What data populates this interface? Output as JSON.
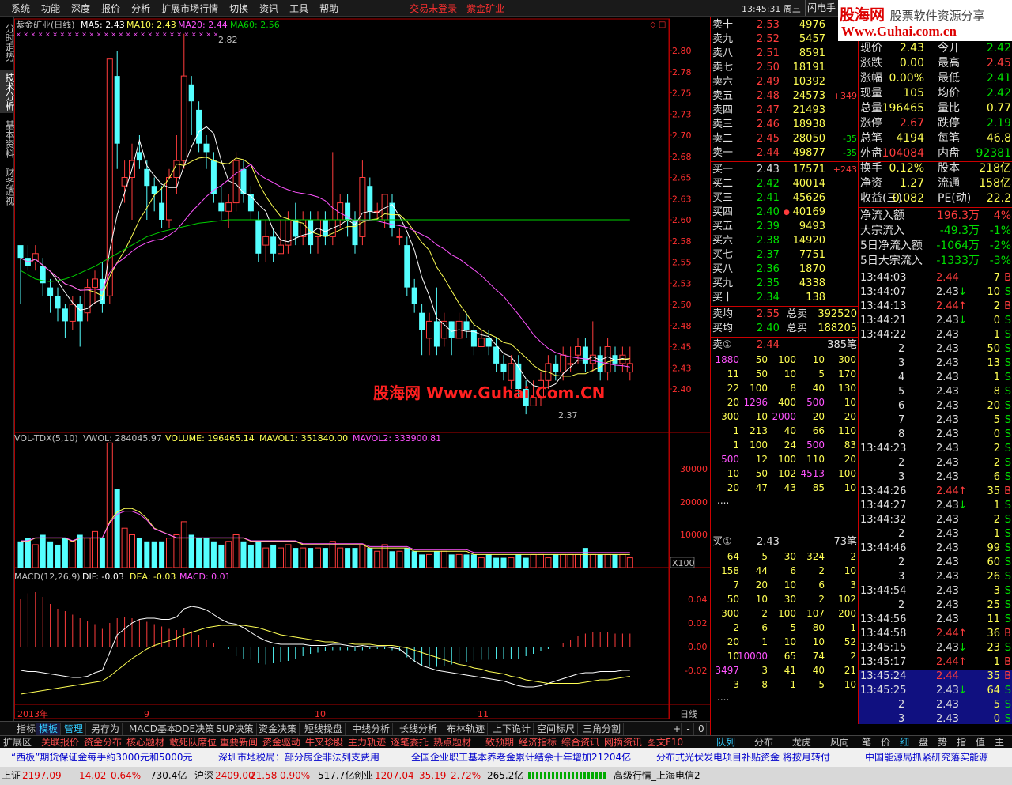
{
  "menu": {
    "items": [
      "系统",
      "功能",
      "深度",
      "报价",
      "分析",
      "扩展市场行情",
      "切换",
      "资讯",
      "工具",
      "帮助"
    ],
    "trade_status": "交易未登录",
    "stock_name": "紫金矿业",
    "clock": "13:45:31 周三",
    "flash": "闪电手"
  },
  "logo": {
    "line1a": "股海网",
    "line1b": "股票软件资源分享",
    "line2": "Www.Guhai.com.cn"
  },
  "side_tabs": [
    "分时走势",
    "技术分析",
    "基本资料",
    "财务透视"
  ],
  "chart": {
    "title": "紫金矿业(日线)",
    "ma5": "MA5: 2.43",
    "ma10": "MA10: 2.43",
    "ma20": "MA20: 2.44",
    "ma60": "MA60: 2.56",
    "high_mark": "2.82",
    "low_mark": "2.37",
    "price_ticks": [
      "2.80",
      "2.78",
      "2.75",
      "2.73",
      "2.70",
      "2.68",
      "2.65",
      "2.63",
      "2.60",
      "2.58",
      "2.55",
      "2.53",
      "2.50",
      "2.48",
      "2.45",
      "2.43",
      "2.40"
    ],
    "watermark": "股海网 Www.Guhai.Com.CN",
    "vol_title": "VOL-TDX(5,10)",
    "vwol": "VWOL: 284045.97",
    "volume": "VOLUME: 196465.14",
    "mavol1": "MAVOL1: 351840.00",
    "mavol2": "MAVOL2: 333900.81",
    "vol_ticks": [
      "30000",
      "20000",
      "10000"
    ],
    "vol_unit": "X100",
    "macd_title": "MACD(12,26,9)",
    "dif": "DIF: -0.03",
    "dea": "DEA: -0.03",
    "macd": "MACD: 0.01",
    "macd_ticks": [
      "0.04",
      "0.02",
      "0.00",
      "-0.02"
    ],
    "x_labels": [
      "2013年",
      "9",
      "10",
      "11"
    ],
    "period": "日线"
  },
  "bottom_tabs": [
    "指标",
    "模板",
    "管理",
    "另存为",
    "MACD基本",
    "DDE决策",
    "SUP决策",
    "资金决策",
    "短线操盘",
    "中线分析",
    "长线分析",
    "布林轨迹",
    "上下诡计",
    "空间标尺",
    "三角分割"
  ],
  "bottom_tab_ctrl": [
    "+",
    "-",
    "0"
  ],
  "tabbar2": [
    "扩展区",
    "关联报价",
    "资金分布",
    "核心题材",
    "敢死队席位",
    "重要新闻",
    "资金驱动",
    "牛叉珍股",
    "主力轨迹",
    "逐笔委托",
    "热点题材",
    "一致预期",
    "经济指标",
    "综合资讯",
    "网摘资讯",
    "图文F10"
  ],
  "tabbar2_right": [
    "队列",
    "分布",
    "龙虎",
    "风向"
  ],
  "tabbar3": [
    "笔",
    "价",
    "细",
    "盘",
    "势",
    "指",
    "值",
    "主"
  ],
  "sells": [
    [
      "卖十",
      "2.53",
      "4976",
      ""
    ],
    [
      "卖九",
      "2.52",
      "5457",
      ""
    ],
    [
      "卖八",
      "2.51",
      "8591",
      ""
    ],
    [
      "卖七",
      "2.50",
      "18191",
      ""
    ],
    [
      "卖六",
      "2.49",
      "10392",
      ""
    ],
    [
      "卖五",
      "2.48",
      "24573",
      "+349"
    ],
    [
      "卖四",
      "2.47",
      "21493",
      ""
    ],
    [
      "卖三",
      "2.46",
      "18938",
      ""
    ],
    [
      "卖二",
      "2.45",
      "28050",
      "-35"
    ],
    [
      "卖一",
      "2.44",
      "49877",
      "-35"
    ]
  ],
  "buys": [
    [
      "买一",
      "2.43",
      "17571",
      "+243"
    ],
    [
      "买二",
      "2.42",
      "40014",
      ""
    ],
    [
      "买三",
      "2.41",
      "45626",
      ""
    ],
    [
      "买四",
      "2.40",
      "40169",
      ""
    ],
    [
      "买五",
      "2.39",
      "9493",
      ""
    ],
    [
      "买六",
      "2.38",
      "14920",
      ""
    ],
    [
      "买七",
      "2.37",
      "7751",
      ""
    ],
    [
      "买八",
      "2.36",
      "1870",
      ""
    ],
    [
      "买九",
      "2.35",
      "4338",
      ""
    ],
    [
      "买十",
      "2.34",
      "138",
      ""
    ]
  ],
  "avg": {
    "sell_avg_label": "卖均",
    "sell_avg": "2.55",
    "sell_total_label": "总卖",
    "sell_total": "392520",
    "buy_avg_label": "买均",
    "buy_avg": "2.40",
    "buy_total_label": "总买",
    "buy_total": "188205"
  },
  "sell_queue": {
    "label": "卖①",
    "price": "2.44",
    "count": "385笔",
    "rows": [
      [
        "1880",
        "50",
        "100",
        "10",
        "300"
      ],
      [
        "11",
        "50",
        "10",
        "5",
        "170"
      ],
      [
        "22",
        "100",
        "8",
        "40",
        "130"
      ],
      [
        "20",
        "1296",
        "400",
        "500",
        "10"
      ],
      [
        "300",
        "10",
        "2000",
        "20",
        "20"
      ],
      [
        "1",
        "213",
        "40",
        "66",
        "110"
      ],
      [
        "1",
        "100",
        "24",
        "500",
        "83"
      ],
      [
        "500",
        "12",
        "100",
        "110",
        "20"
      ],
      [
        "10",
        "50",
        "102",
        "4513",
        "100"
      ],
      [
        "20",
        "47",
        "43",
        "85",
        "10"
      ]
    ],
    "more": "...."
  },
  "buy_queue": {
    "label": "买①",
    "price": "2.43",
    "count": "73笔",
    "rows": [
      [
        "64",
        "5",
        "30",
        "324",
        "2"
      ],
      [
        "158",
        "44",
        "6",
        "2",
        "10"
      ],
      [
        "7",
        "20",
        "10",
        "6",
        "3"
      ],
      [
        "50",
        "10",
        "30",
        "2",
        "102"
      ],
      [
        "300",
        "2",
        "100",
        "107",
        "200"
      ],
      [
        "2",
        "6",
        "5",
        "80",
        "1"
      ],
      [
        "20",
        "1",
        "10",
        "10",
        "52"
      ],
      [
        "10",
        "10000",
        "65",
        "74",
        "2"
      ],
      [
        "3497",
        "3",
        "41",
        "40",
        "21"
      ],
      [
        "3",
        "8",
        "1",
        "5",
        "10"
      ]
    ],
    "more": "...."
  },
  "stats": [
    [
      "现价",
      "2.43",
      "今开",
      "2.42"
    ],
    [
      "涨跌",
      "0.00",
      "最高",
      "2.45"
    ],
    [
      "涨幅",
      "0.00%",
      "最低",
      "2.41"
    ],
    [
      "现量",
      "105",
      "均价",
      "2.42"
    ],
    [
      "总量",
      "196465",
      "量比",
      "0.77"
    ],
    [
      "涨停",
      "2.67",
      "跌停",
      "2.19"
    ],
    [
      "总笔",
      "4194",
      "每笔",
      "46.8"
    ],
    [
      "外盘",
      "104084",
      "内盘",
      "92381"
    ],
    [
      "换手",
      "0.12%",
      "股本",
      "218亿"
    ],
    [
      "净资",
      "1.27",
      "流通",
      "158亿"
    ],
    [
      "收益(三)",
      "0.082",
      "PE(动)",
      "22.2"
    ]
  ],
  "flows": [
    [
      "净流入额",
      "196.3万",
      "4%"
    ],
    [
      "大宗流入",
      "-49.3万",
      "-1%"
    ],
    [
      "5日净流入额",
      "-1064万",
      "-2%"
    ],
    [
      "5日大宗流入",
      "-1333万",
      "-3%"
    ]
  ],
  "ticks": [
    [
      "13:44:03",
      "2.44",
      "7",
      "B"
    ],
    [
      "13:44:07",
      "2.43",
      "10",
      "S"
    ],
    [
      "13:44:13",
      "2.44",
      "2",
      "B"
    ],
    [
      "13:44:21",
      "2.43",
      "0",
      "S"
    ],
    [
      "13:44:22",
      "2.43",
      "1",
      "S"
    ],
    [
      "2",
      "2.43",
      "50",
      "S"
    ],
    [
      "3",
      "2.43",
      "13",
      "S"
    ],
    [
      "4",
      "2.43",
      "1",
      "S"
    ],
    [
      "5",
      "2.43",
      "8",
      "S"
    ],
    [
      "6",
      "2.43",
      "20",
      "S"
    ],
    [
      "7",
      "2.43",
      "5",
      "S"
    ],
    [
      "8",
      "2.43",
      "0",
      "S"
    ],
    [
      "13:44:23",
      "2.43",
      "2",
      "S"
    ],
    [
      "2",
      "2.43",
      "2",
      "S"
    ],
    [
      "3",
      "2.43",
      "6",
      "S"
    ],
    [
      "13:44:26",
      "2.44",
      "35",
      "B"
    ],
    [
      "13:44:27",
      "2.43",
      "1",
      "S"
    ],
    [
      "13:44:32",
      "2.43",
      "2",
      "S"
    ],
    [
      "2",
      "2.43",
      "1",
      "S"
    ],
    [
      "13:44:46",
      "2.43",
      "99",
      "S"
    ],
    [
      "2",
      "2.43",
      "60",
      "S"
    ],
    [
      "3",
      "2.43",
      "26",
      "S"
    ],
    [
      "13:44:54",
      "2.43",
      "3",
      "S"
    ],
    [
      "2",
      "2.43",
      "25",
      "S"
    ],
    [
      "13:44:56",
      "2.43",
      "11",
      "S"
    ],
    [
      "13:44:58",
      "2.44",
      "36",
      "B"
    ],
    [
      "13:45:15",
      "2.43",
      "23",
      "S"
    ],
    [
      "13:45:17",
      "2.44",
      "1",
      "B"
    ],
    [
      "13:45:24",
      "2.44",
      "35",
      "B"
    ],
    [
      "13:45:25",
      "2.43",
      "64",
      "S"
    ],
    [
      "2",
      "2.43",
      "5",
      "S"
    ],
    [
      "3",
      "2.43",
      "0",
      "S"
    ]
  ],
  "ticker": [
    "“西板”期货保证金每手约3000元和5000元",
    "深圳市地税局：部分房企非法列支费用",
    "全国企业职工基本养老金累计结余十年增加21204亿",
    "分布式光伏发电项目补贴资金 将按月转付",
    "中国能源局抓紧研究落实能源"
  ],
  "status": {
    "sh_label": "上证",
    "sh": "2197.09",
    "sh_chg": "14.02",
    "sh_pct": "0.64%",
    "sh_amt": "730.4亿",
    "sz_label": "沪深",
    "sz": "2409.00",
    "sz_chg": "21.58",
    "sz_pct": "0.90%",
    "sz_amt": "517.7亿",
    "cy_label": "创业",
    "cy": "1207.04",
    "cy_chg": "35.19",
    "cy_pct": "2.72%",
    "cy_amt": "265.2亿",
    "server": "高级行情_上海电信2"
  },
  "colors": {
    "up": "#ff3c3c",
    "down": "#54ffff",
    "ma5": "#ffffff",
    "ma10": "#ffff54",
    "ma20": "#ff54ff",
    "ma60": "#00d000"
  },
  "candles": [
    [
      2.57,
      2.555,
      2.56,
      2.5
    ],
    [
      2.555,
      2.545,
      2.57,
      2.54
    ],
    [
      2.55,
      2.56,
      2.57,
      2.54
    ],
    [
      2.545,
      2.525,
      2.555,
      2.51
    ],
    [
      2.52,
      2.51,
      2.53,
      2.49
    ],
    [
      2.51,
      2.495,
      2.52,
      2.48
    ],
    [
      2.495,
      2.48,
      2.5,
      2.46
    ],
    [
      2.48,
      2.5,
      2.51,
      2.47
    ],
    [
      2.5,
      2.48,
      2.51,
      2.45
    ],
    [
      2.49,
      2.52,
      2.53,
      2.48
    ],
    [
      2.52,
      2.53,
      2.54,
      2.5
    ],
    [
      2.53,
      2.5,
      2.55,
      2.49
    ],
    [
      2.51,
      2.79,
      2.79,
      2.5
    ],
    [
      2.77,
      2.69,
      2.8,
      2.66
    ],
    [
      2.64,
      2.65,
      2.67,
      2.62
    ],
    [
      2.65,
      2.67,
      2.69,
      2.6
    ],
    [
      2.68,
      2.67,
      2.7,
      2.66
    ],
    [
      2.66,
      2.64,
      2.67,
      2.6
    ],
    [
      2.64,
      2.63,
      2.65,
      2.61
    ],
    [
      2.62,
      2.6,
      2.64,
      2.59
    ],
    [
      2.6,
      2.65,
      2.66,
      2.59
    ],
    [
      2.65,
      2.67,
      2.7,
      2.63
    ],
    [
      2.67,
      2.77,
      2.82,
      2.66
    ],
    [
      2.76,
      2.74,
      2.77,
      2.7
    ],
    [
      2.73,
      2.69,
      2.74,
      2.68
    ],
    [
      2.69,
      2.68,
      2.7,
      2.66
    ],
    [
      2.67,
      2.63,
      2.68,
      2.62
    ],
    [
      2.62,
      2.61,
      2.64,
      2.6
    ],
    [
      2.61,
      2.62,
      2.63,
      2.59
    ],
    [
      2.62,
      2.67,
      2.68,
      2.61
    ],
    [
      2.66,
      2.63,
      2.67,
      2.62
    ],
    [
      2.63,
      2.61,
      2.64,
      2.6
    ],
    [
      2.6,
      2.56,
      2.61,
      2.55
    ],
    [
      2.57,
      2.58,
      2.6,
      2.55
    ],
    [
      2.58,
      2.56,
      2.59,
      2.55
    ],
    [
      2.56,
      2.57,
      2.6,
      2.56
    ],
    [
      2.57,
      2.6,
      2.61,
      2.56
    ],
    [
      2.6,
      2.58,
      2.62,
      2.57
    ],
    [
      2.58,
      2.6,
      2.61,
      2.57
    ],
    [
      2.6,
      2.57,
      2.61,
      2.56
    ],
    [
      2.58,
      2.6,
      2.61,
      2.56
    ],
    [
      2.6,
      2.58,
      2.61,
      2.57
    ],
    [
      2.58,
      2.6,
      2.68,
      2.57
    ],
    [
      2.6,
      2.62,
      2.63,
      2.59
    ],
    [
      2.62,
      2.6,
      2.63,
      2.58
    ],
    [
      2.6,
      2.57,
      2.61,
      2.56
    ],
    [
      2.58,
      2.65,
      2.67,
      2.57
    ],
    [
      2.64,
      2.61,
      2.65,
      2.6
    ],
    [
      2.61,
      2.61,
      2.62,
      2.6
    ],
    [
      2.6,
      2.63,
      2.63,
      2.59
    ],
    [
      2.62,
      2.59,
      2.63,
      2.58
    ],
    [
      2.58,
      2.58,
      2.59,
      2.57
    ],
    [
      2.57,
      2.52,
      2.58,
      2.51
    ],
    [
      2.52,
      2.5,
      2.53,
      2.49
    ],
    [
      2.49,
      2.47,
      2.5,
      2.44
    ],
    [
      2.46,
      2.48,
      2.49,
      2.44
    ],
    [
      2.48,
      2.45,
      2.52,
      2.44
    ],
    [
      2.46,
      2.48,
      2.49,
      2.45
    ],
    [
      2.48,
      2.46,
      2.48,
      2.44
    ],
    [
      2.46,
      2.48,
      2.49,
      2.46
    ],
    [
      2.48,
      2.47,
      2.49,
      2.46
    ],
    [
      2.47,
      2.45,
      2.48,
      2.44
    ],
    [
      2.45,
      2.46,
      2.47,
      2.45
    ],
    [
      2.46,
      2.45,
      2.47,
      2.44
    ],
    [
      2.45,
      2.43,
      2.46,
      2.42
    ],
    [
      2.43,
      2.42,
      2.44,
      2.41
    ],
    [
      2.41,
      2.43,
      2.44,
      2.4
    ],
    [
      2.43,
      2.4,
      2.44,
      2.39
    ],
    [
      2.4,
      2.38,
      2.41,
      2.37
    ],
    [
      2.38,
      2.39,
      2.41,
      2.38
    ],
    [
      2.39,
      2.41,
      2.42,
      2.38
    ],
    [
      2.41,
      2.43,
      2.44,
      2.4
    ],
    [
      2.43,
      2.42,
      2.44,
      2.41
    ],
    [
      2.42,
      2.44,
      2.45,
      2.41
    ],
    [
      2.43,
      2.43,
      2.45,
      2.42
    ],
    [
      2.44,
      2.45,
      2.46,
      2.43
    ],
    [
      2.45,
      2.43,
      2.46,
      2.42
    ],
    [
      2.43,
      2.44,
      2.48,
      2.42
    ],
    [
      2.44,
      2.42,
      2.45,
      2.41
    ],
    [
      2.42,
      2.45,
      2.46,
      2.41
    ],
    [
      2.44,
      2.43,
      2.45,
      2.42
    ],
    [
      2.43,
      2.44,
      2.45,
      2.42
    ],
    [
      2.42,
      2.43,
      2.45,
      2.41
    ]
  ],
  "ma60": [
    2.54,
    2.535,
    2.53,
    2.528,
    2.527,
    2.528,
    2.53,
    2.533,
    2.537,
    2.541,
    2.545,
    2.55,
    2.555,
    2.56,
    2.565,
    2.57,
    2.575,
    2.58,
    2.583,
    2.586,
    2.588,
    2.59,
    2.592,
    2.594,
    2.596,
    2.597,
    2.598,
    2.599,
    2.6,
    2.6,
    2.6,
    2.6,
    2.6,
    2.6,
    2.6,
    2.6,
    2.6,
    2.6,
    2.6,
    2.6,
    2.6,
    2.6,
    2.6,
    2.6,
    2.6,
    2.6,
    2.6,
    2.6,
    2.6,
    2.6,
    2.6,
    2.6,
    2.6,
    2.6,
    2.6,
    2.6,
    2.6,
    2.6,
    2.6,
    2.6,
    2.6,
    2.6,
    2.6,
    2.6,
    2.6,
    2.6,
    2.6,
    2.6,
    2.6,
    2.6,
    2.6,
    2.6,
    2.6,
    2.6,
    2.6,
    2.6,
    2.6,
    2.6,
    2.6,
    2.6,
    2.6,
    2.6,
    2.6
  ],
  "volumes": [
    8,
    9,
    7,
    10,
    8,
    7,
    9,
    8,
    10,
    9,
    11,
    9,
    38,
    24,
    12,
    10,
    9,
    8,
    8,
    8,
    9,
    10,
    14,
    10,
    9,
    9,
    8,
    7,
    8,
    10,
    8,
    7,
    8,
    6,
    7,
    6,
    7,
    6,
    6,
    6,
    6,
    6,
    8,
    6,
    6,
    6,
    7,
    6,
    5,
    7,
    5,
    5,
    6,
    5,
    4,
    4,
    5,
    5,
    4,
    4,
    4,
    4,
    3,
    4,
    3,
    3,
    3,
    4,
    3,
    4,
    4,
    3,
    4,
    4,
    4,
    4,
    6,
    4,
    4,
    4,
    4,
    4,
    3
  ],
  "vol_ma": [
    8,
    8,
    9,
    9,
    9,
    9,
    9,
    8,
    9,
    9,
    9,
    9,
    14,
    17,
    18,
    18,
    17,
    15,
    12,
    11,
    10,
    9,
    9,
    9,
    9,
    9,
    9,
    9,
    9,
    9,
    9,
    8,
    8,
    8,
    8,
    8,
    8,
    8,
    7,
    7,
    7,
    7,
    7,
    7,
    7,
    7,
    7,
    6,
    6,
    6,
    6,
    6,
    6,
    5,
    5,
    5,
    5,
    5,
    5,
    5,
    5,
    4,
    4,
    4,
    4,
    4,
    4,
    4,
    4,
    4,
    4,
    4,
    4,
    4,
    4,
    4,
    4,
    4,
    4,
    4,
    4,
    4,
    4
  ],
  "macd_bars": [
    0.04,
    0.045,
    0.046,
    0.042,
    0.036,
    0.032,
    0.03,
    0.027,
    0.024,
    0.022,
    0.019,
    0.015,
    0.02,
    0.024,
    0.025,
    0.024,
    0.023,
    0.021,
    0.019,
    0.017,
    0.015,
    0.014,
    0.016,
    0.013,
    0.01,
    0.006,
    0.003,
    0.0,
    -0.002,
    -0.008,
    -0.01,
    -0.011,
    -0.014,
    -0.015,
    -0.014,
    -0.013,
    -0.012,
    -0.01,
    -0.008,
    -0.006,
    -0.005,
    -0.004,
    -0.003,
    -0.003,
    -0.003,
    -0.004,
    -0.003,
    -0.002,
    -0.002,
    -0.002,
    -0.003,
    -0.004,
    -0.009,
    -0.013,
    -0.016,
    -0.017,
    -0.017,
    -0.016,
    -0.015,
    -0.014,
    -0.013,
    -0.012,
    -0.011,
    -0.011,
    -0.01,
    -0.01,
    -0.01,
    -0.01,
    -0.008,
    -0.006,
    -0.004,
    -0.002,
    0.0,
    0.003,
    0.006,
    0.009,
    0.011,
    0.012,
    0.012,
    0.012,
    0.011,
    0.011,
    0.011
  ],
  "dif": [
    -0.02,
    -0.021,
    -0.021,
    -0.022,
    -0.023,
    -0.024,
    -0.025,
    -0.026,
    -0.026,
    -0.025,
    -0.022,
    -0.02,
    -0.005,
    0.01,
    0.015,
    0.02,
    0.023,
    0.024,
    0.024,
    0.023,
    0.023,
    0.025,
    0.032,
    0.034,
    0.033,
    0.031,
    0.027,
    0.023,
    0.02,
    0.019,
    0.016,
    0.012,
    0.008,
    0.005,
    0.003,
    0.002,
    0.002,
    0.002,
    0.002,
    0.001,
    0.001,
    0.001,
    0.002,
    0.002,
    0.001,
    0.0,
    0.001,
    0.0,
    0.0,
    0.0,
    -0.001,
    -0.002,
    -0.007,
    -0.012,
    -0.016,
    -0.018,
    -0.02,
    -0.021,
    -0.022,
    -0.023,
    -0.024,
    -0.025,
    -0.026,
    -0.027,
    -0.028,
    -0.029,
    -0.031,
    -0.033,
    -0.034,
    -0.034,
    -0.033,
    -0.031,
    -0.029,
    -0.027,
    -0.025,
    -0.023,
    -0.022,
    -0.022,
    -0.021,
    -0.021,
    -0.021,
    -0.02,
    -0.02
  ],
  "dea": [
    -0.04,
    -0.039,
    -0.038,
    -0.037,
    -0.036,
    -0.035,
    -0.034,
    -0.033,
    -0.032,
    -0.031,
    -0.03,
    -0.029,
    -0.025,
    -0.02,
    -0.015,
    -0.01,
    -0.006,
    -0.002,
    0.001,
    0.003,
    0.005,
    0.007,
    0.01,
    0.012,
    0.014,
    0.016,
    0.017,
    0.018,
    0.018,
    0.018,
    0.018,
    0.017,
    0.016,
    0.014,
    0.012,
    0.01,
    0.009,
    0.008,
    0.007,
    0.006,
    0.005,
    0.004,
    0.004,
    0.003,
    0.003,
    0.002,
    0.002,
    0.002,
    0.001,
    0.001,
    0.001,
    0.0,
    -0.001,
    -0.003,
    -0.005,
    -0.007,
    -0.009,
    -0.011,
    -0.013,
    -0.015,
    -0.016,
    -0.018,
    -0.019,
    -0.021,
    -0.022,
    -0.023,
    -0.025,
    -0.026,
    -0.028,
    -0.029,
    -0.03,
    -0.031,
    -0.031,
    -0.031,
    -0.031,
    -0.031,
    -0.03,
    -0.029,
    -0.028,
    -0.028,
    -0.027,
    -0.026,
    -0.025
  ]
}
